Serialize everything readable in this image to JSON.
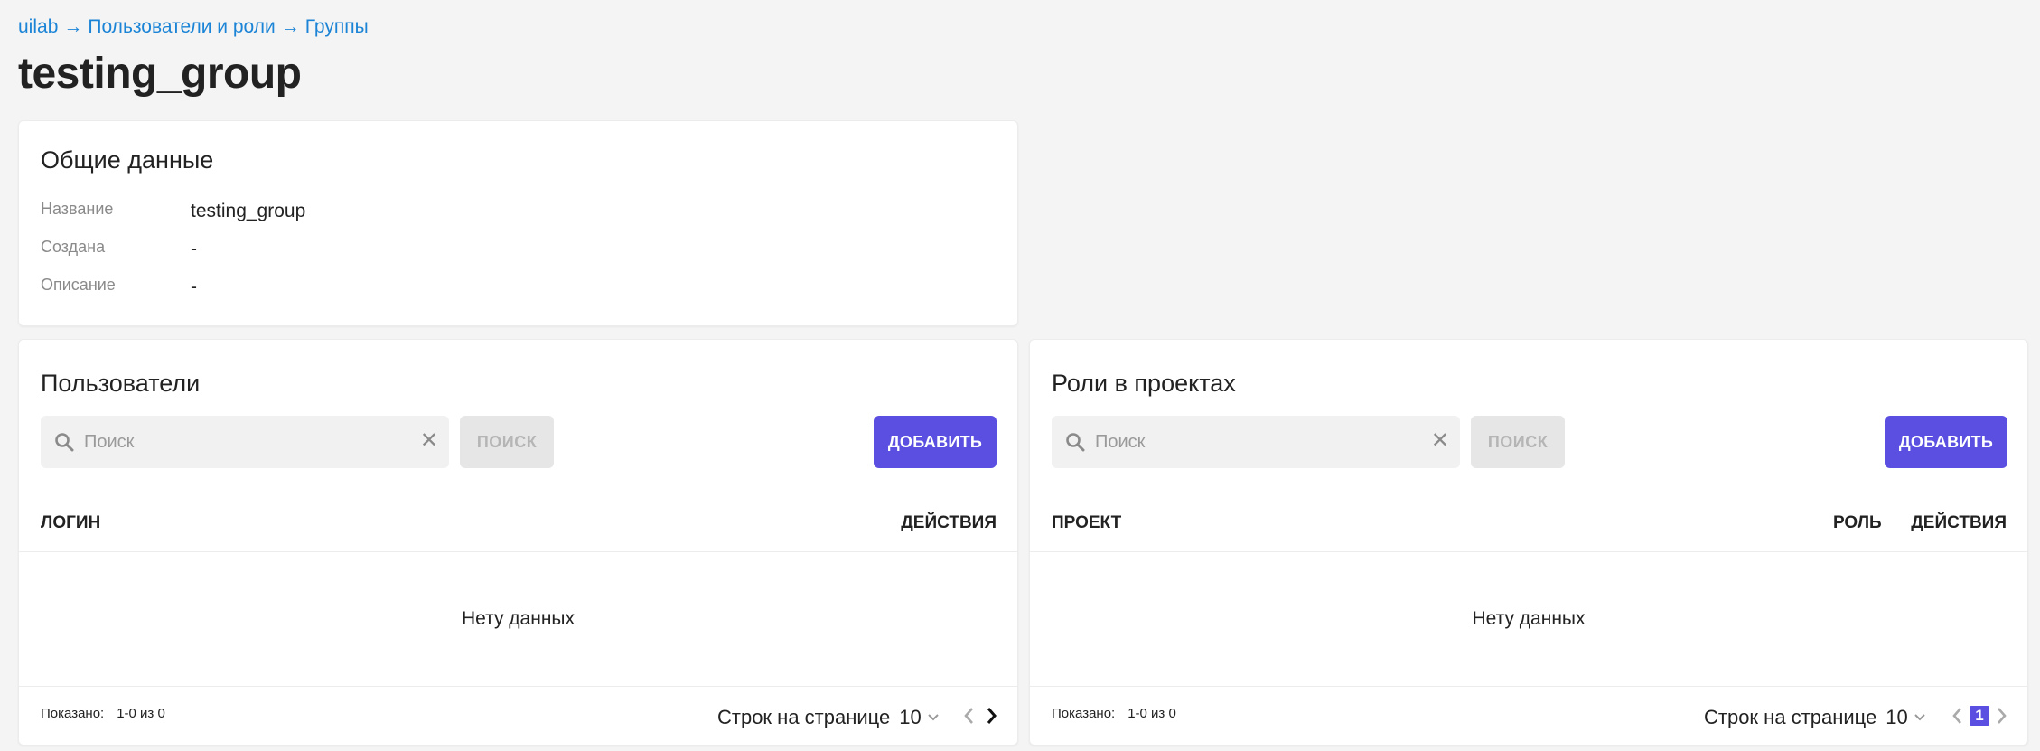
{
  "breadcrumb": {
    "items": [
      "uilab",
      "Пользователи и роли",
      "Группы"
    ],
    "separator": "→"
  },
  "page_title": "testing_group",
  "general": {
    "title": "Общие данные",
    "fields": [
      {
        "label": "Название",
        "value": "testing_group"
      },
      {
        "label": "Создана",
        "value": "-"
      },
      {
        "label": "Описание",
        "value": "-"
      }
    ]
  },
  "users": {
    "title": "Пользователи",
    "search_placeholder": "Поиск",
    "search_button": "ПОИСК",
    "add_button": "ДОБАВИТЬ",
    "columns": [
      "ЛОГИН",
      "ДЕЙСТВИЯ"
    ],
    "empty_text": "Нету данных",
    "shown_label": "Показано:",
    "shown_value": "1-0 из 0",
    "rows_per_page_label": "Строк на странице",
    "rows_per_page_value": "10"
  },
  "roles": {
    "title": "Роли в проектах",
    "search_placeholder": "Поиск",
    "search_button": "ПОИСК",
    "add_button": "ДОБАВИТЬ",
    "columns": [
      "ПРОЕКТ",
      "РОЛЬ",
      "ДЕЙСТВИЯ"
    ],
    "empty_text": "Нету данных",
    "shown_label": "Показано:",
    "shown_value": "1-0 из 0",
    "rows_per_page_label": "Строк на странице",
    "rows_per_page_value": "10",
    "current_page": "1"
  },
  "icons": {
    "search": "search-icon",
    "clear": "close-icon",
    "dropdown": "chevron-down-icon",
    "prev": "chevron-left-icon",
    "next": "chevron-right-icon"
  },
  "colors": {
    "link": "#1b84d6",
    "accent": "#5a4fe0",
    "background": "#f4f4f4"
  }
}
